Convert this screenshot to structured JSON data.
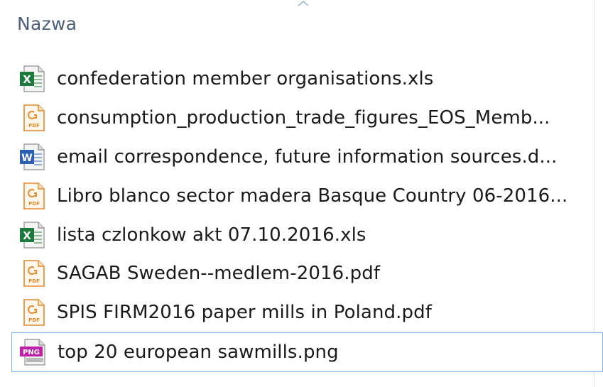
{
  "column_header": {
    "name_label": "Nazwa"
  },
  "files": [
    {
      "name": "confederation member organisations.xls",
      "icon": "excel-file-icon",
      "selected": false
    },
    {
      "name": "consumption_production_trade_figures_EOS_Memb...",
      "icon": "pdf-file-icon",
      "selected": false
    },
    {
      "name": "email correspondence, future information sources.d...",
      "icon": "word-file-icon",
      "selected": false
    },
    {
      "name": "Libro blanco sector madera Basque Country 06-2016...",
      "icon": "pdf-file-icon",
      "selected": false
    },
    {
      "name": "lista czlonkow akt 07.10.2016.xls",
      "icon": "excel-file-icon",
      "selected": false
    },
    {
      "name": "SAGAB Sweden--medlem-2016.pdf",
      "icon": "pdf-file-icon",
      "selected": false
    },
    {
      "name": "SPIS FIRM2016 paper mills in Poland.pdf",
      "icon": "pdf-file-icon",
      "selected": false
    },
    {
      "name": "top 20 european sawmills.png",
      "icon": "png-file-icon",
      "selected": true
    }
  ],
  "icon_labels": {
    "excel": "X",
    "word": "W",
    "pdf": "PDF",
    "png": "PNG"
  },
  "colors": {
    "header_text": "#4c607a",
    "selection_border": "#7fb0ea",
    "excel_green": "#1e7a3c",
    "word_blue": "#2b5fb3",
    "pdf_orange": "#e8892a",
    "png_magenta": "#c01fa8"
  }
}
